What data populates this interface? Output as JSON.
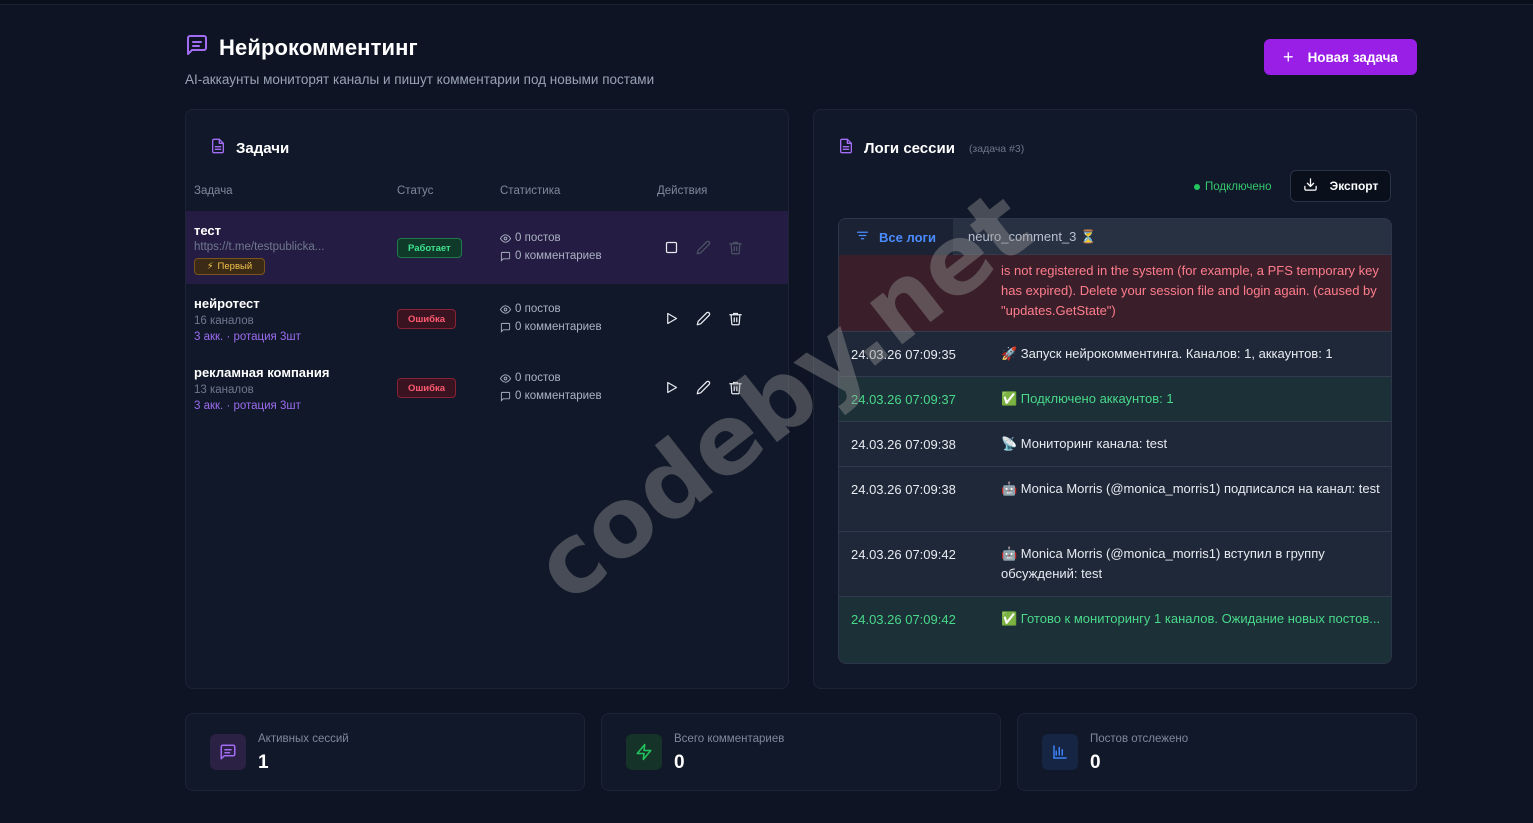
{
  "header": {
    "title": "Нейрокомментинг",
    "subtitle": "AI-аккаунты мониторят каналы и пишут комментарии под новыми постами",
    "new_task_label": "Новая задача"
  },
  "tasks": {
    "title": "Задачи",
    "columns": [
      "Задача",
      "Статус",
      "Статистика",
      "Действия"
    ],
    "rows": [
      {
        "name": "тест",
        "meta": "https://t.me/testpublicka...",
        "badge": "Первый",
        "status": "Работает",
        "posts": "0 постов",
        "comments": "0 комментариев"
      },
      {
        "name": "нейротест",
        "meta": "16 каналов",
        "meta2": "3 акк. · ротация 3шт",
        "status": "Ошибка",
        "posts": "0 постов",
        "comments": "0 комментариев"
      },
      {
        "name": "рекламная компания",
        "meta": "13 каналов",
        "meta2": "3 акк. · ротация 3шт",
        "status": "Ошибка",
        "posts": "0 постов",
        "comments": "0 комментариев"
      }
    ]
  },
  "logs": {
    "title": "Логи сессии",
    "subtitle": "(задача #3)",
    "connection": "Подключено",
    "export_label": "Экспорт",
    "tabs": [
      "Все логи",
      "neuro_comment_3 ⏳"
    ],
    "entries": [
      {
        "time": "",
        "message": "is not registered in the system (for example, a PFS temporary key has expired). Delete your session file and login again. (caused by \"updates.GetState\")",
        "type": "error"
      },
      {
        "time": "24.03.26 07:09:35",
        "message": "🚀 Запуск нейрокомментинга. Каналов: 1, аккаунтов: 1",
        "type": "info"
      },
      {
        "time": "24.03.26 07:09:37",
        "message": "✅ Подключено аккаунтов: 1",
        "type": "success"
      },
      {
        "time": "24.03.26 07:09:38",
        "message": "📡 Мониторинг канала: test",
        "type": "info"
      },
      {
        "time": "24.03.26 07:09:38",
        "message": "🤖 Monica Morris (@monica_morris1) подписался на канал: test",
        "type": "info"
      },
      {
        "time": "24.03.26 07:09:42",
        "message": "🤖 Monica Morris (@monica_morris1) вступил в группу обсуждений: test",
        "type": "info"
      },
      {
        "time": "24.03.26 07:09:42",
        "message": "✅ Готово к мониторингу 1 каналов. Ожидание новых постов...",
        "type": "success"
      }
    ]
  },
  "stats": [
    {
      "label": "Активных сессий",
      "value": "1",
      "icon": "message-icon",
      "color": "#8b5cf6"
    },
    {
      "label": "Всего комментариев",
      "value": "0",
      "icon": "zap-icon",
      "color": "#22c55e"
    },
    {
      "label": "Постов отслежено",
      "value": "0",
      "icon": "bar-chart-icon",
      "color": "#3b82f6"
    }
  ],
  "watermark": "codeby.net"
}
